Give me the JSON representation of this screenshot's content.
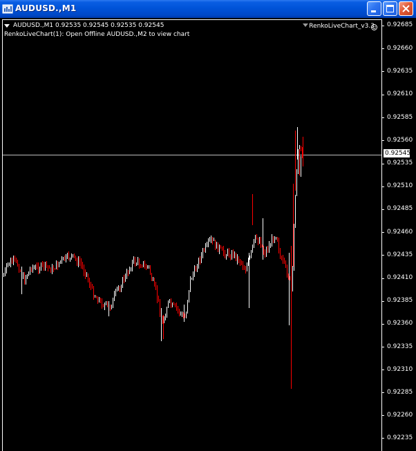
{
  "window": {
    "title": "AUDUSD.,M1",
    "buttons": [
      "minimize",
      "maximize",
      "close"
    ]
  },
  "chart": {
    "symbol_line": "AUDUSD.,M1  0.92535 0.92545 0.92535 0.92545",
    "indicator_line": "RenkoLiveChart(1): Open Offline AUDUSD.,M2 to view chart",
    "expert_advisor": "RenkoLiveChart_v3.3",
    "current_price": "0.92545",
    "price_axis": [
      "0.92685",
      "0.92660",
      "0.92635",
      "0.92610",
      "0.92585",
      "0.92560",
      "0.92535",
      "0.92510",
      "0.92485",
      "0.92460",
      "0.92435",
      "0.92410",
      "0.92385",
      "0.92360",
      "0.92335",
      "0.92310",
      "0.92285",
      "0.92260",
      "0.92235"
    ],
    "colors": {
      "background": "#000000",
      "bull_bar": "#ffffff",
      "bear_bar": "#ff0000",
      "bid_line": "#c0c0c0",
      "text": "#ffffff"
    }
  }
}
